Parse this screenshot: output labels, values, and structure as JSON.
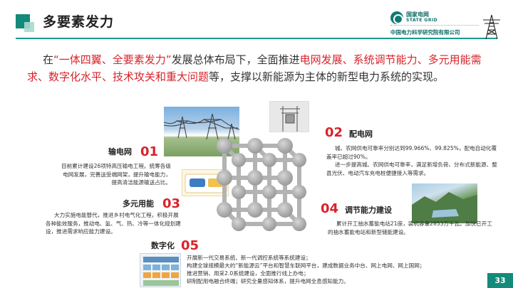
{
  "header": {
    "title": "多要素发力",
    "logo_cn": "国家电网",
    "logo_en": "STATE GRID",
    "institute": "中国电力科学研究院有限公司"
  },
  "intro": {
    "p1": "在",
    "h1": "“一体四翼、全要素发力”",
    "p2": "发展总体布局下，全面推进",
    "h2": "电网发展、系统调节能力、多元用能需求、数字化水平、技术攻关和重大问题",
    "p3": "等，支撑以新能源为主体的新型电力系统的实现。"
  },
  "sections": {
    "s1": {
      "title": "输电网",
      "num": "01",
      "text": "目前累计建设26项特高压输电工程。统筹各级电网发展，完善送受端网架，提升输电能力，提高清洁能源输送占比。"
    },
    "s2": {
      "title": "配电网",
      "num": "02",
      "line1": "城、农网供电可靠率分别达到99.966%、99.825%，配电自动化覆盖率已超过90%。",
      "line2": "进一步提高城、农网供电可靠率，满足新增负荷、分布式新能源、整县光伏、电动汽车充电桩便捷接入等需求。"
    },
    "s3": {
      "title": "多元用能",
      "num": "03",
      "text": "大力实施电能替代，推进乡村电气化工程，积极开展各种能效服务，推动电、氢、气、热、冷等一体化规划建设，推进需求响应能力建设。"
    },
    "s4": {
      "title": "调节能力建设",
      "num": "04",
      "text": "累计开工抽水蓄能电站21座，装机容量2853万千瓦。加快已开工的抽水蓄能电站和新型储能建设。"
    },
    "s5": {
      "title": "数字化",
      "num": "05",
      "line1": "开展新一代交易系统、新一代调控系统等系统建设；",
      "line2": "构建全球规模最大的“新能源云”平台和智慧车联网平台，建成数据业务中台、网上电网、网上国网；",
      "line3": "推进营销、用采2.0系统建设，全面推行线上办电；",
      "line4": "研制配用电融合终端；研究全量感知体系，提升电网全息感知能力。"
    }
  },
  "page_number": "33",
  "colors": {
    "accent": "#138a7a",
    "highlight": "#d8232a"
  },
  "icons": [
    "state-grid-logo-icon",
    "transmission-tower-icon",
    "lattice-node-icon"
  ]
}
